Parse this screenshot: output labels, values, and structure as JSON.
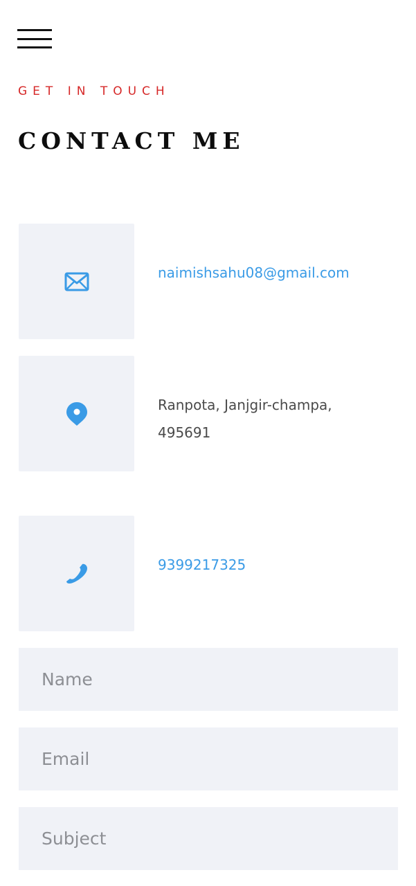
{
  "menu": {
    "icon": "hamburger-menu-icon"
  },
  "header": {
    "kicker": "GET IN TOUCH",
    "title": "CONTACT ME"
  },
  "contact": {
    "email": {
      "icon": "envelope-icon",
      "text": "naimishsahu08@gmail.com"
    },
    "address": {
      "icon": "map-pin-icon",
      "line1": "Ranpota, Janjgir-champa,",
      "line2": "495691"
    },
    "phone": {
      "icon": "phone-icon",
      "text": "9399217325"
    }
  },
  "form": {
    "name_placeholder": "Name",
    "email_placeholder": "Email",
    "subject_placeholder": "Subject"
  },
  "colors": {
    "accent_red": "#d62828",
    "link_blue": "#3a9be6",
    "box_background": "#f0f2f7",
    "heading": "#0d0d0d"
  }
}
